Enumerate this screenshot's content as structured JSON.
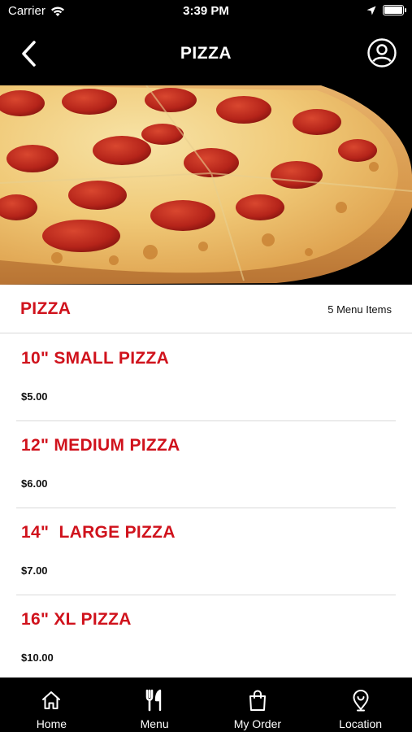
{
  "status_bar": {
    "carrier": "Carrier",
    "time": "3:39 PM",
    "icons": [
      "wifi-icon",
      "location-arrow-icon",
      "battery-icon"
    ]
  },
  "nav": {
    "title": "PIZZA",
    "back_icon": "chevron-left-icon",
    "profile_icon": "user-circle-icon"
  },
  "hero": {
    "image": "pepperoni-pizza-photo"
  },
  "section": {
    "title": "PIZZA",
    "count_label": "5 Menu Items"
  },
  "menu_items": [
    {
      "name": "10\" SMALL PIZZA",
      "price": "$5.00"
    },
    {
      "name": "12\" MEDIUM PIZZA",
      "price": "$6.00"
    },
    {
      "name": "14\"  LARGE PIZZA",
      "price": "$7.00"
    },
    {
      "name": "16\" XL PIZZA",
      "price": "$10.00"
    }
  ],
  "tabs": [
    {
      "label": "Home",
      "icon": "home-icon"
    },
    {
      "label": "Menu",
      "icon": "fork-knife-icon"
    },
    {
      "label": "My Order",
      "icon": "shopping-bag-icon"
    },
    {
      "label": "Location",
      "icon": "map-pin-icon"
    }
  ],
  "colors": {
    "accent_red": "#d0121c",
    "bar_black": "#000000",
    "divider": "#d9d9d9"
  }
}
